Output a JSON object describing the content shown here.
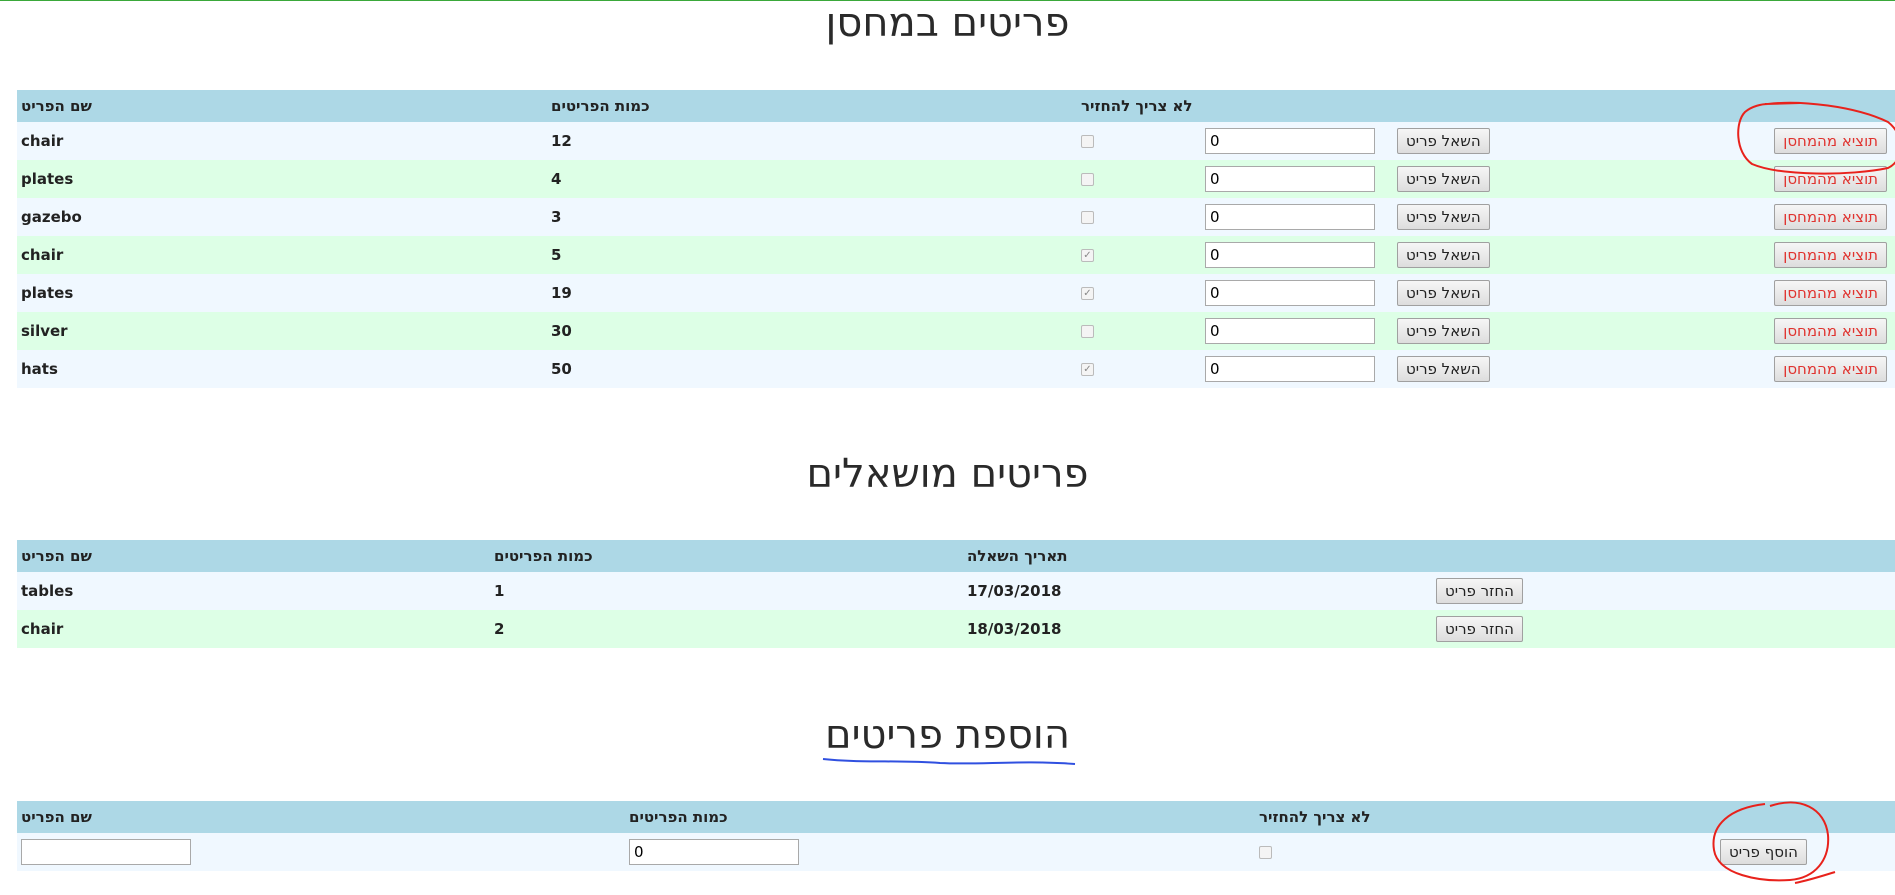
{
  "warehouse": {
    "title": "פריטים במחסן",
    "headers": {
      "name": "שם הפריט",
      "quantity": "כמות הפריטים",
      "no_return": "לא צריך להחזיר"
    },
    "borrow_label": "השאל פריט",
    "remove_label": "תוציא מהמחסן",
    "rows": [
      {
        "name": "chair",
        "quantity": "12",
        "no_return": false,
        "borrow_qty": "0"
      },
      {
        "name": "plates",
        "quantity": "4",
        "no_return": false,
        "borrow_qty": "0"
      },
      {
        "name": "gazebo",
        "quantity": "3",
        "no_return": false,
        "borrow_qty": "0"
      },
      {
        "name": "chair",
        "quantity": "5",
        "no_return": true,
        "borrow_qty": "0"
      },
      {
        "name": "plates",
        "quantity": "19",
        "no_return": true,
        "borrow_qty": "0"
      },
      {
        "name": "silver",
        "quantity": "30",
        "no_return": false,
        "borrow_qty": "0"
      },
      {
        "name": "hats",
        "quantity": "50",
        "no_return": true,
        "borrow_qty": "0"
      }
    ]
  },
  "borrowed": {
    "title": "פריטים מושאלים",
    "headers": {
      "name": "שם הפריט",
      "quantity": "כמות הפריטים",
      "date": "תאריך השאלה"
    },
    "return_label": "החזר פריט",
    "rows": [
      {
        "name": "tables",
        "quantity": "1",
        "date": "17/03/2018"
      },
      {
        "name": "chair",
        "quantity": "2",
        "date": "18/03/2018"
      }
    ]
  },
  "add_items": {
    "title": "הוספת פריטים",
    "headers": {
      "name": "שם הפריט",
      "quantity": "כמות הפריטים",
      "no_return": "לא צריך להחזיר"
    },
    "name_value": "",
    "quantity_value": "0",
    "no_return": false,
    "add_label": "הוסף פריט"
  },
  "colors": {
    "header_bg": "#add8e6",
    "row_odd": "#f0f8ff",
    "row_even": "#ddffe6",
    "danger_text": "#e0332f",
    "annotation_red": "#e8221c",
    "annotation_blue": "#3050e0"
  }
}
